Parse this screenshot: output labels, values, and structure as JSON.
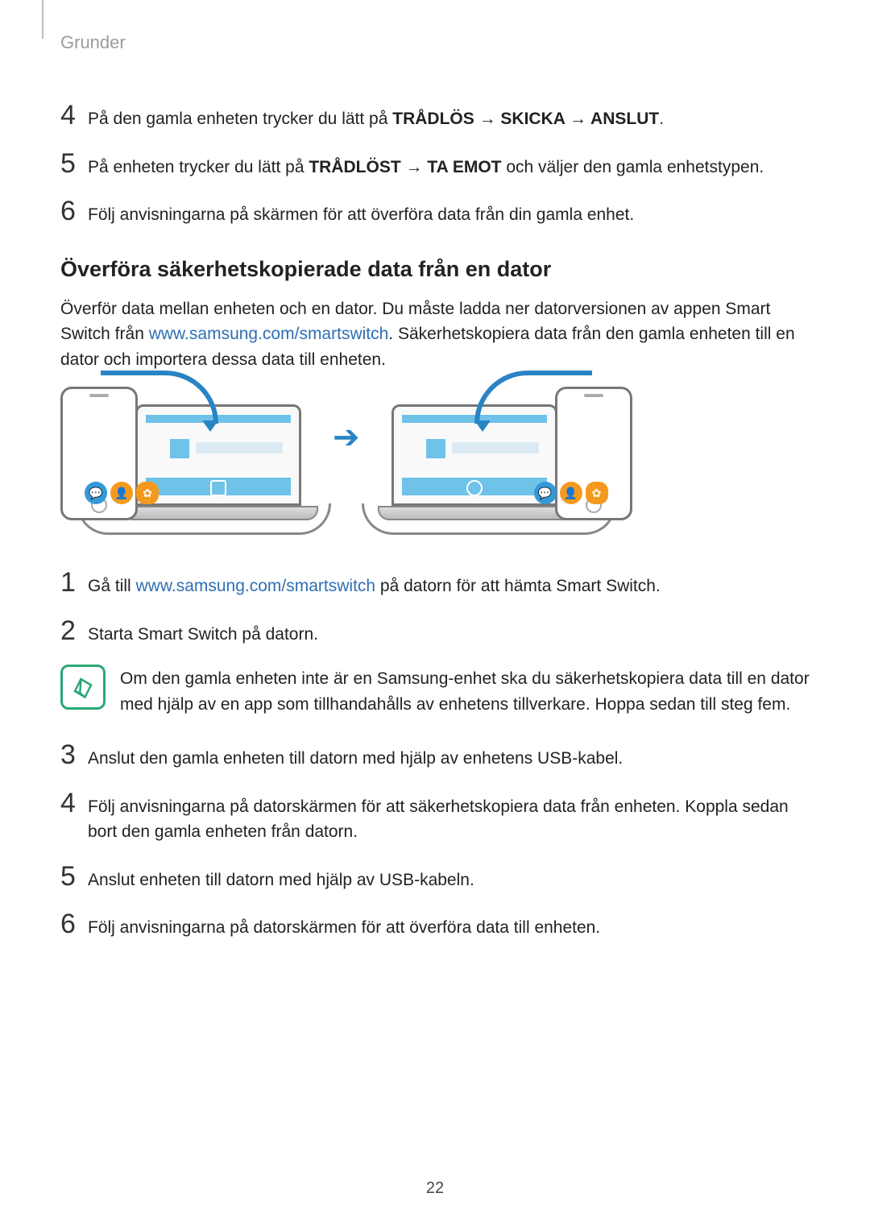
{
  "header": {
    "section_label": "Grunder"
  },
  "first_steps": [
    {
      "num": "4",
      "parts": [
        {
          "t": "plain",
          "v": "På den gamla enheten trycker du lätt på "
        },
        {
          "t": "bold",
          "v": "TRÅDLÖS"
        },
        {
          "t": "bold",
          "v": " → "
        },
        {
          "t": "bold",
          "v": "SKICKA"
        },
        {
          "t": "bold",
          "v": " → "
        },
        {
          "t": "bold",
          "v": "ANSLUT"
        },
        {
          "t": "plain",
          "v": "."
        }
      ]
    },
    {
      "num": "5",
      "parts": [
        {
          "t": "plain",
          "v": "På enheten trycker du lätt på "
        },
        {
          "t": "bold",
          "v": "TRÅDLÖST"
        },
        {
          "t": "bold",
          "v": " → "
        },
        {
          "t": "bold",
          "v": "TA EMOT"
        },
        {
          "t": "plain",
          "v": " och väljer den gamla enhetstypen."
        }
      ]
    },
    {
      "num": "6",
      "parts": [
        {
          "t": "plain",
          "v": "Följ anvisningarna på skärmen för att överföra data från din gamla enhet."
        }
      ]
    }
  ],
  "section_title": "Överföra säkerhetskopierade data från en dator",
  "intro": {
    "before_link": "Överför data mellan enheten och en dator. Du måste ladda ner datorversionen av appen Smart Switch från ",
    "link_text": "www.samsung.com/smartswitch",
    "link_href": "http://www.samsung.com/smartswitch",
    "after_link": ". Säkerhetskopiera data från den gamla enheten till en dator och importera dessa data till enheten."
  },
  "second_steps_a": [
    {
      "num": "1",
      "parts": [
        {
          "t": "plain",
          "v": "Gå till "
        },
        {
          "t": "link",
          "v": "www.samsung.com/smartswitch"
        },
        {
          "t": "plain",
          "v": " på datorn för att hämta Smart Switch."
        }
      ]
    },
    {
      "num": "2",
      "parts": [
        {
          "t": "plain",
          "v": "Starta Smart Switch på datorn."
        }
      ]
    }
  ],
  "note": "Om den gamla enheten inte är en Samsung-enhet ska du säkerhetskopiera data till en dator med hjälp av en app som tillhandahålls av enhetens tillverkare. Hoppa sedan till steg fem.",
  "second_steps_b": [
    {
      "num": "3",
      "parts": [
        {
          "t": "plain",
          "v": "Anslut den gamla enheten till datorn med hjälp av enhetens USB-kabel."
        }
      ]
    },
    {
      "num": "4",
      "parts": [
        {
          "t": "plain",
          "v": "Följ anvisningarna på datorskärmen för att säkerhetskopiera data från enheten. Koppla sedan bort den gamla enheten från datorn."
        }
      ]
    },
    {
      "num": "5",
      "parts": [
        {
          "t": "plain",
          "v": "Anslut enheten till datorn med hjälp av USB-kabeln."
        }
      ]
    },
    {
      "num": "6",
      "parts": [
        {
          "t": "plain",
          "v": "Följ anvisningarna på datorskärmen för att överföra data till enheten."
        }
      ]
    }
  ],
  "page_number": "22"
}
